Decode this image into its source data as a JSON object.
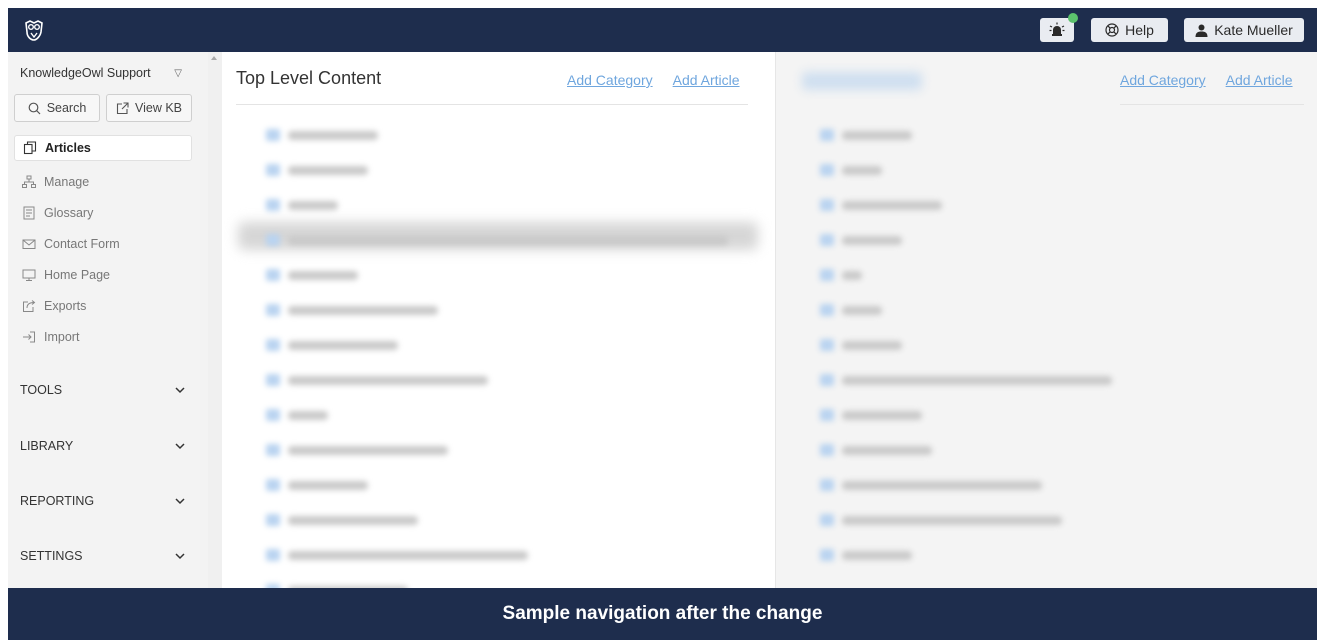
{
  "topbar": {
    "help_label": "Help",
    "user_name": "Kate Mueller",
    "notification_dot_color": "#5cc26d",
    "bg_color": "#1e2d4d"
  },
  "sidebar": {
    "kb_name": "KnowledgeOwl Support",
    "search_label": "Search",
    "view_kb_label": "View KB",
    "items": [
      {
        "label": "Articles",
        "icon": "articles-icon",
        "active": true
      },
      {
        "label": "Manage",
        "icon": "manage-icon",
        "active": false
      },
      {
        "label": "Glossary",
        "icon": "glossary-icon",
        "active": false
      },
      {
        "label": "Contact Form",
        "icon": "envelope-icon",
        "active": false
      },
      {
        "label": "Home Page",
        "icon": "monitor-icon",
        "active": false
      },
      {
        "label": "Exports",
        "icon": "export-icon",
        "active": false
      },
      {
        "label": "Import",
        "icon": "import-icon",
        "active": false
      }
    ],
    "sections": [
      "TOOLS",
      "LIBRARY",
      "REPORTING",
      "SETTINGS"
    ]
  },
  "left_panel": {
    "title": "Top Level Content",
    "add_category": "Add Category",
    "add_article": "Add Article"
  },
  "right_panel": {
    "add_category": "Add Category",
    "add_article": "Add Article"
  },
  "caption": "Sample navigation after the change",
  "colors": {
    "link": "#6fa6de",
    "caption_bg": "#1e2d4d"
  }
}
